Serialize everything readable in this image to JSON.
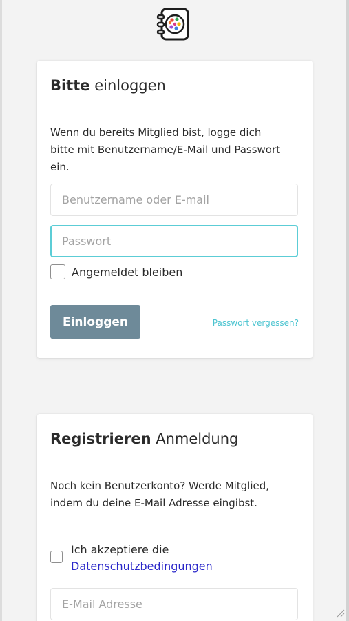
{
  "app": {
    "logo_icon": "illustrated-logo-icon"
  },
  "login": {
    "title_strong": "Bitte",
    "title_rest": " einloggen",
    "description": "Wenn du bereits Mitglied bist, logge dich bitte mit Benutzername/E-Mail und Passwort ein.",
    "username_placeholder": "Benutzername oder E-mail",
    "password_placeholder": "Passwort",
    "remember_label": "Angemeldet bleiben",
    "remember_checked": false,
    "submit_label": "Einloggen",
    "forgot_label": "Passwort vergessen?"
  },
  "register": {
    "title_strong": "Registrieren",
    "title_rest": " Anmeldung",
    "description": "Noch kein Benutzerkonto? Werde Mitglied, indem du deine E-Mail Adresse eingibst.",
    "terms_prefix": "Ich akzeptiere die",
    "terms_link": "Datenschutzbedingungen",
    "terms_checked": false,
    "email_placeholder": "E-Mail Adresse"
  },
  "colors": {
    "button": "#6e8a99",
    "focus_border": "#5ccdd6",
    "forgot_link": "#4cc4d0",
    "terms_link": "#2a27c9",
    "background": "#f3f3f3"
  }
}
